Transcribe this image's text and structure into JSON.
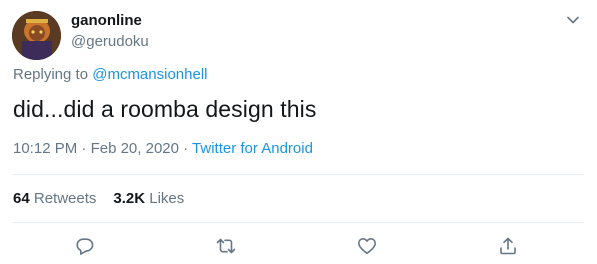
{
  "tweet": {
    "display_name": "ganonline",
    "handle": "@gerudoku",
    "replying_prefix": "Replying to",
    "replying_to": "@mcmansionhell",
    "text": "did...did a roomba design this",
    "time": "10:12 PM",
    "date": "Feb 20, 2020",
    "separator": "·",
    "source": "Twitter for Android"
  },
  "stats": {
    "retweets_count": "64",
    "retweets_label": "Retweets",
    "likes_count": "3.2K",
    "likes_label": "Likes"
  },
  "icons": {
    "caret": "chevron-down-icon",
    "reply": "reply-icon",
    "retweet": "retweet-icon",
    "like": "heart-icon",
    "share": "share-icon"
  },
  "colors": {
    "text_primary": "#14171a",
    "text_secondary": "#657786",
    "link": "#1b95e0",
    "divider": "#e6ecf0"
  }
}
